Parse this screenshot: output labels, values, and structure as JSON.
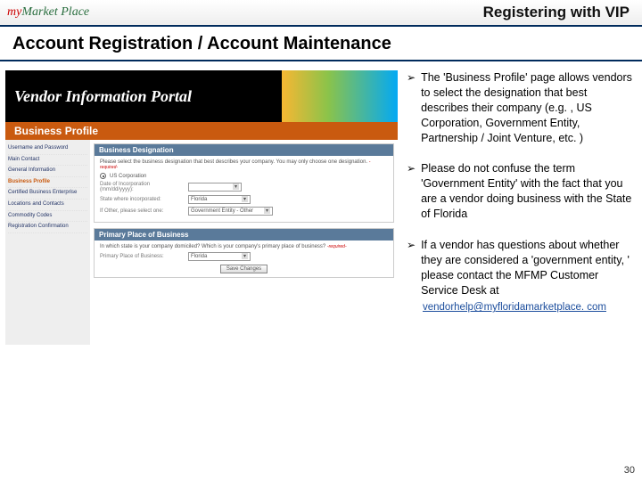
{
  "header": {
    "logo_my": "my",
    "logo_mp": "Market Place",
    "title": "Registering with VIP"
  },
  "heading": "Account Registration / Account Maintenance",
  "vip": {
    "banner_text": "Vendor Information Portal",
    "subbar": "Business Profile",
    "nav": {
      "items": [
        "Username and Password",
        "Main Contact",
        "General Information",
        "Business Profile",
        "Certified Business Enterprise",
        "Locations and Contacts",
        "Commodity Codes",
        "Registration Confirmation"
      ],
      "active_index": 3
    },
    "panel1": {
      "title": "Business Designation",
      "instruction": "Please select the business designation that best describes your company. You may only choose one designation.",
      "required": "-required-",
      "radio_label": "US Corporation",
      "date_label": "Date of Incorporation (mm/dd/yyyy):",
      "state_label": "State where incorporated:",
      "state_value": "Florida",
      "other_label": "If Other, please select one:",
      "other_value": "Government Entity - Other"
    },
    "panel2": {
      "title": "Primary Place of Business",
      "question": "In which state is your company domiciled? Which is your company's primary place of business?",
      "required": "-required-",
      "pob_label": "Primary Place of Business:",
      "pob_value": "Florida",
      "save_btn": "Save Changes"
    }
  },
  "bullets": [
    "The 'Business Profile' page allows vendors to select the designation that best describes their company (e.g. , US Corporation, Government Entity, Partnership / Joint Venture, etc. )",
    "Please do not confuse the term 'Government Entity' with the fact that you are a vendor doing business with the State of Florida",
    "If a vendor has questions about whether they are considered a 'government entity, ' please contact the MFMP Customer Service Desk at"
  ],
  "email": "vendorhelp@myfloridamarketplace. com",
  "page_number": "30"
}
